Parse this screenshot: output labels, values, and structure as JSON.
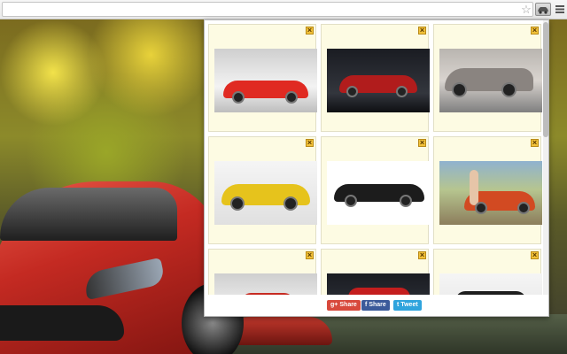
{
  "browser": {
    "toolbar_icons": [
      "star-icon",
      "extension-car-icon",
      "menu-icon"
    ]
  },
  "popup": {
    "tiles": [
      {
        "name": "red-supercar-tile",
        "close": "×",
        "colors": {
          "car": "#e02a22",
          "bg": "grey"
        }
      },
      {
        "name": "dark-red-car-tile",
        "close": "×",
        "colors": {
          "car": "#b11c1c",
          "bg": "dark"
        }
      },
      {
        "name": "silver-concept-car-tile",
        "close": "×",
        "colors": {
          "car": "#8a8480",
          "bg": "show"
        }
      },
      {
        "name": "yellow-coupe-tile",
        "close": "×",
        "colors": {
          "car": "#e6c31c",
          "bg": "light"
        }
      },
      {
        "name": "black-supercar-tile",
        "close": "×",
        "colors": {
          "car": "#1c1c1c",
          "bg": "white"
        }
      },
      {
        "name": "orange-car-model-tile",
        "close": "×",
        "colors": {
          "car": "#d24a22",
          "bg": "outdoor"
        }
      },
      {
        "name": "red-roadster-tile",
        "close": "×",
        "colors": {
          "car": "#c72b22",
          "bg": "grey"
        }
      },
      {
        "name": "red-racecar-tile",
        "close": "×",
        "colors": {
          "car": "#c41e1e",
          "bg": "dark"
        }
      },
      {
        "name": "black-spoiler-car-tile",
        "close": "×",
        "colors": {
          "car": "#1d1d1d",
          "bg": "light"
        }
      }
    ],
    "share": {
      "gplus_label": "Share",
      "gplus_glyph": "g+",
      "facebook_label": "Share",
      "facebook_glyph": "f",
      "twitter_label": "Tweet",
      "twitter_glyph": "t"
    },
    "colors": {
      "tile_bg": "#fdfbe3",
      "gplus": "#d8493c",
      "facebook": "#3b5a9a",
      "twitter": "#2fa4dd"
    }
  }
}
